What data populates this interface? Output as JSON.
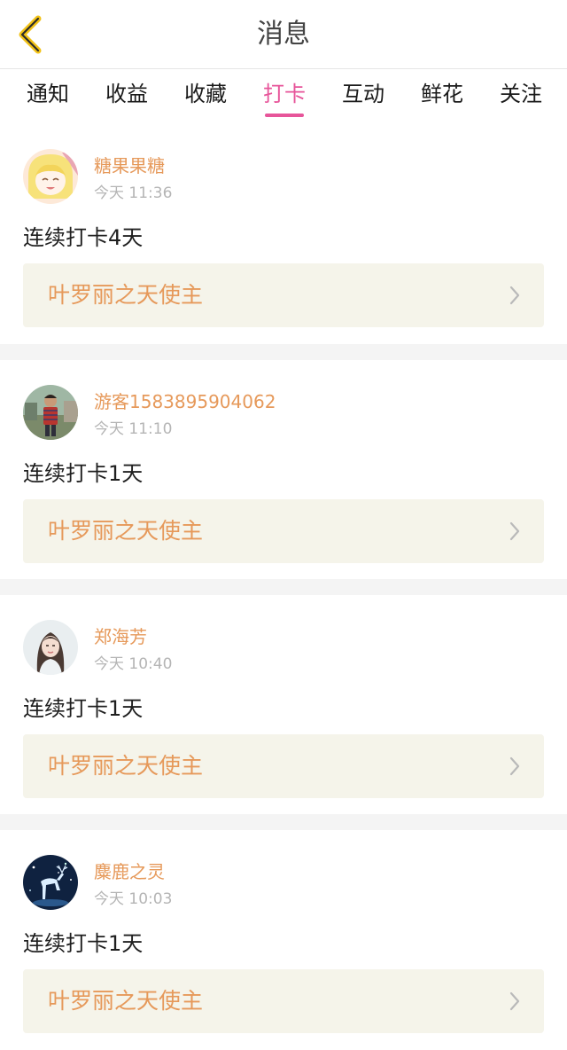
{
  "header": {
    "title": "消息"
  },
  "tabs": [
    {
      "label": "通知"
    },
    {
      "label": "收益"
    },
    {
      "label": "收藏"
    },
    {
      "label": "打卡"
    },
    {
      "label": "互动"
    },
    {
      "label": "鲜花"
    },
    {
      "label": "关注"
    }
  ],
  "active_tab": "打卡",
  "colors": {
    "accent": "#e7559a",
    "name": "#e6995a",
    "back_icon": "#f2c216"
  },
  "items": [
    {
      "name": "糖果果糖",
      "time": "今天 11:36",
      "text": "连续打卡4天",
      "group": "叶罗丽之天使主"
    },
    {
      "name": "游客1583895904062",
      "time": "今天 11:10",
      "text": "连续打卡1天",
      "group": "叶罗丽之天使主"
    },
    {
      "name": "郑海芳",
      "time": "今天 10:40",
      "text": "连续打卡1天",
      "group": "叶罗丽之天使主"
    },
    {
      "name": "麋鹿之灵",
      "time": "今天 10:03",
      "text": "连续打卡1天",
      "group": "叶罗丽之天使主"
    }
  ]
}
